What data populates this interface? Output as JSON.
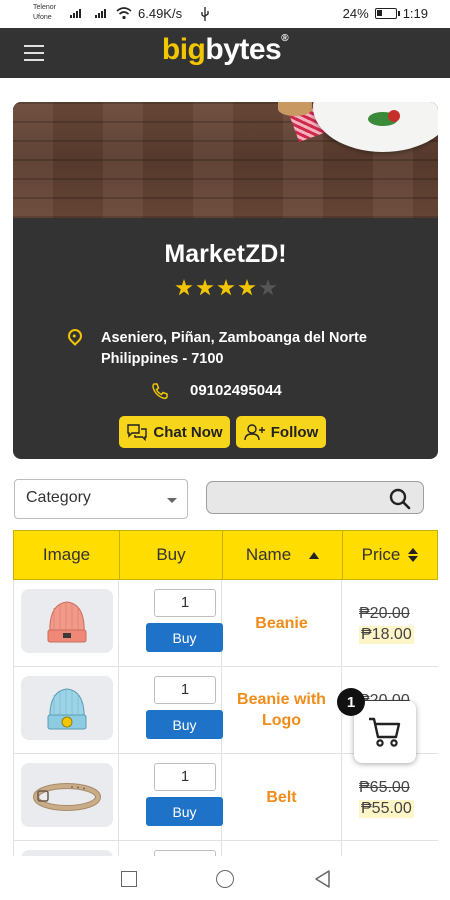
{
  "status_bar": {
    "carrier1": "Telenor",
    "carrier2": "Ufone",
    "net_speed": "6.49K/s",
    "battery": "24%",
    "time": "1:19"
  },
  "app": {
    "brand_part1": "big",
    "brand_part2": "bytes",
    "brand_mark": "®",
    "menu_icon": "hamburger-menu-icon",
    "accent_color": "#f2c600",
    "header_bg": "#333333"
  },
  "store": {
    "name": "MarketZD!",
    "rating": 4,
    "rating_max": 5,
    "address_line1": "Aseniero, Piñan, Zamboanga del Norte",
    "address_line2": "Philippines - 7100",
    "phone": "09102495044",
    "chat_label": "Chat Now",
    "follow_label": "Follow"
  },
  "filters": {
    "category_selected": "Category",
    "search_value": ""
  },
  "table": {
    "headers": [
      "Image",
      "Buy",
      "Name",
      "Price"
    ],
    "buy_label": "Buy",
    "rows": [
      {
        "image_icon": "beanie-pink-icon",
        "qty": "1",
        "name": "Beanie",
        "old_price": "₱20.00",
        "new_price": "₱18.00"
      },
      {
        "image_icon": "beanie-blue-logo-icon",
        "qty": "1",
        "name": "Beanie with Logo",
        "old_price": "₱20.00",
        "new_price": ""
      },
      {
        "image_icon": "belt-icon",
        "qty": "1",
        "name": "Belt",
        "old_price": "₱65.00",
        "new_price": "₱55.00"
      }
    ]
  },
  "cart": {
    "count": "1",
    "icon": "shopping-cart-icon"
  }
}
